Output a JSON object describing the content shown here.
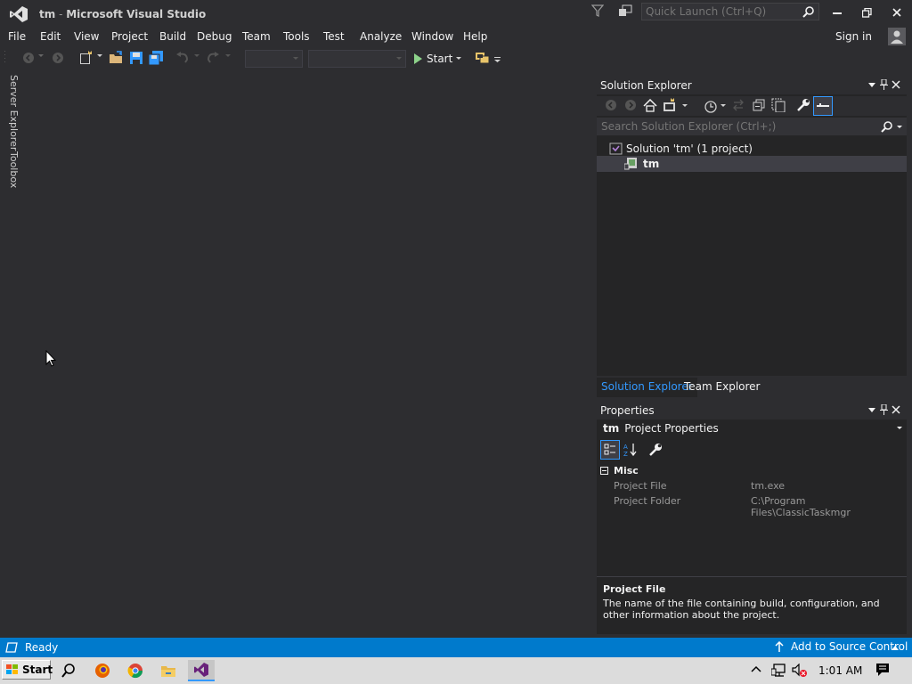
{
  "window": {
    "title_project": "tm",
    "title_sep": " - ",
    "title_app": "Microsoft Visual Studio",
    "quick_launch_placeholder": "Quick Launch (Ctrl+Q)"
  },
  "menu": {
    "items": [
      "File",
      "Edit",
      "View",
      "Project",
      "Build",
      "Debug",
      "Team",
      "Tools",
      "Test",
      "Analyze",
      "Window",
      "Help"
    ],
    "sign_in": "Sign in"
  },
  "toolbar": {
    "start_label": "Start"
  },
  "side_tabs": [
    "Server Explorer",
    "Toolbox"
  ],
  "solution_explorer": {
    "title": "Solution Explorer",
    "search_placeholder": "Search Solution Explorer (Ctrl+;)",
    "solution_label": "Solution 'tm' (1 project)",
    "project_label": "tm",
    "tabs": [
      "Solution Explorer",
      "Team Explorer"
    ]
  },
  "properties": {
    "title": "Properties",
    "object_name": "tm",
    "object_type": "Project Properties",
    "category": "Misc",
    "rows": [
      {
        "name": "Project File",
        "value": "tm.exe"
      },
      {
        "name": "Project Folder",
        "value": "C:\\Program Files\\ClassicTaskmgr"
      }
    ],
    "desc_title": "Project File",
    "desc_text": "The name of the file containing build, configuration, and other information about the project."
  },
  "status": {
    "text": "Ready",
    "source_control": "Add to Source Control"
  },
  "taskbar": {
    "start_label": "Start",
    "clock": "1:01 AM"
  },
  "colors": {
    "accent": "#007acc",
    "vs_purple": "#68217a",
    "link_blue": "#3399ff"
  }
}
